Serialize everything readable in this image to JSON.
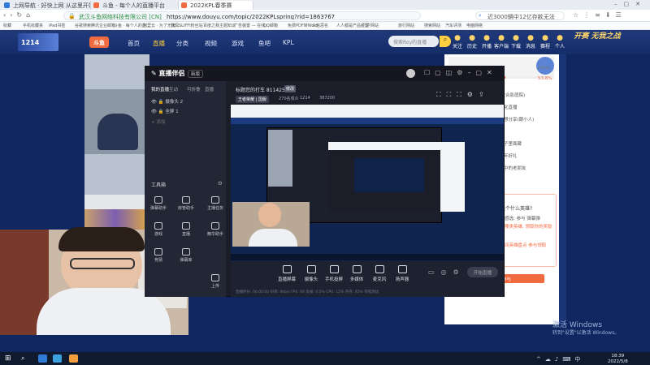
{
  "browser": {
    "tabs": [
      {
        "title": "上网导航 · 好快上网 从这里开始",
        "active": false,
        "color": "#2f7bd6"
      },
      {
        "title": "斗鱼 - 每个人的直播平台",
        "active": false,
        "color": "#f26a3f"
      },
      {
        "title": "2022KPL春季赛",
        "active": true,
        "color": "#f26a3f"
      }
    ],
    "url_site": "武汉斗鱼网络科技有限公司 [CN]",
    "url": "https://www.douyu.com/topic/2022KPLspring?rid=1863767",
    "search_text": "近3000辆中12亿存款无法",
    "bookmarks": [
      "收藏",
      "手机收藏夹",
      "iPad书签",
      "谷歌搜索",
      "腾讯企业邮箱",
      "斗鱼 · 每个人的直...",
      "阿里云 · 为了无法...",
      "我佩SLIFFI粉丝站",
      "百度之我主题知识",
      "广告装置 — 在线...",
      "QQ邮箱",
      "免费PDF转Word",
      "众信思名",
      "人人都是产品经理",
      "门户网站",
      "旅行网站",
      "搜索网站",
      "汽车评测",
      "电脑网络"
    ]
  },
  "site": {
    "promo": "1214",
    "logo": "斗鱼",
    "nav": [
      {
        "label": "首页",
        "active": false
      },
      {
        "label": "直播",
        "active": true
      },
      {
        "label": "分类",
        "active": false
      },
      {
        "label": "视频",
        "active": false
      },
      {
        "label": "游戏",
        "active": false
      },
      {
        "label": "鱼吧",
        "active": false
      },
      {
        "label": "KPL",
        "active": false
      }
    ],
    "search_placeholder": "搜索Roy的直播",
    "header_icons": [
      "关注",
      "历史",
      "开播",
      "客户端",
      "下载",
      "消息",
      "赛程",
      "个人"
    ],
    "banner_text": "开赛 无我之战"
  },
  "obs_app": {
    "title": "直播伴侣",
    "version": "新版",
    "side_tabs": [
      "我的直播",
      "互动",
      "可折叠",
      "直播"
    ],
    "sources": [
      "摄像头 2",
      "全屏 1",
      "添加"
    ],
    "tools_title": "工具箱",
    "tools": [
      "弹幕助手",
      "房管助手",
      "主播任务",
      "游戏",
      "直播",
      "精华助手",
      "竞猜",
      "弹幕库",
      "上传"
    ],
    "room_title": "标题您的打车 8114256",
    "room_badge": "修改",
    "room_category": "王者荣耀 | 国服",
    "room_stats": [
      "270名观众",
      "1214",
      "387200"
    ],
    "controls": [
      "直播屏幕",
      "摄像头",
      "手机投屏",
      "多媒体",
      "麦克风",
      "扬声器"
    ],
    "golive": "开始直播",
    "status": "直播时长: 00:00:00  码率: 0kb/s  FPS: 60  丢帧: 0.0%  CPU: 12%  内存: 45%  带宽测试"
  },
  "right_panel": {
    "user": "eStar",
    "progress_label": "53.8%",
    "lines": [
      "赢家斗鱼(合影庭院)",
      "前卫职业化直播",
      "一年前就想分享(跟小人)",
      "开心小屋",
      "我的新盒子里面藏",
      "梦幻的多年好礼",
      "猜你喜欢中的老朋友"
    ],
    "card_title": "你是个什么英雄?",
    "card_line1": "手动感选: 参与 弹幕弹",
    "card_line2": "你是哪类英雄, 领取你的奖励",
    "card_line3": "直播间英雄盘点 参与领取",
    "card_button": "立即参与"
  },
  "webcam": {
    "overlay_label": "直播"
  },
  "windows": {
    "watermark_title": "激活 Windows",
    "watermark_sub": "转到\"设置\"以激活 Windows。",
    "time": "18:39",
    "date": "2022/5/8"
  }
}
